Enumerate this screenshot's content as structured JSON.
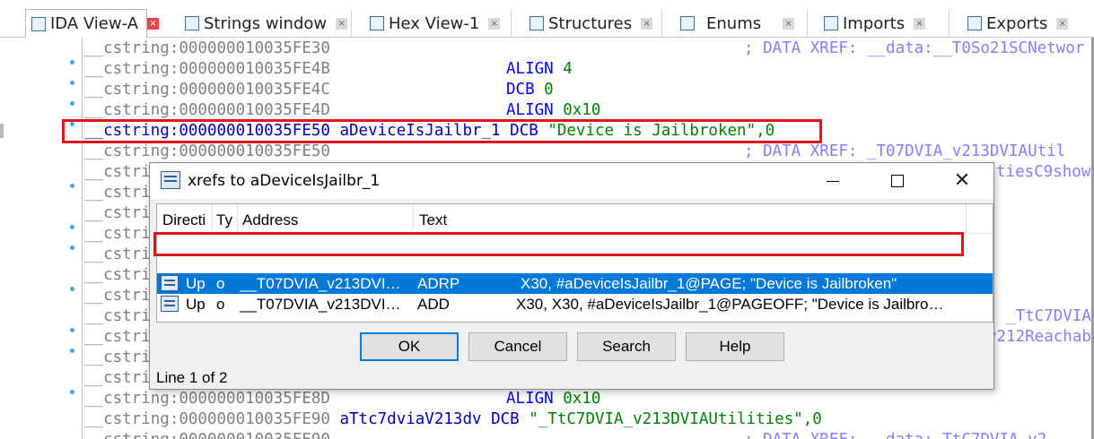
{
  "tabs": [
    {
      "label": "IDA View-A",
      "icon": "ida-view-icon",
      "active": true
    },
    {
      "label": "Strings window",
      "icon": "strings-icon",
      "active": false
    },
    {
      "label": "Hex View-1",
      "icon": "hex-icon",
      "active": false
    },
    {
      "label": "Structures",
      "icon": "structures-icon",
      "active": false
    },
    {
      "label": "Enums",
      "icon": "enums-icon",
      "active": false
    },
    {
      "label": "Imports",
      "icon": "imports-icon",
      "active": false
    },
    {
      "label": "Exports",
      "icon": "exports-icon",
      "active": false
    }
  ],
  "tab_close_glyph": "×",
  "listing": {
    "lines": [
      {
        "addr": "__cstring:000000010035FE30",
        "mn": "",
        "op": "",
        "comment": "; DATA XREF: __data:__T0So21SCNetwor"
      },
      {
        "addr": "__cstring:000000010035FE4B",
        "mn": "ALIGN",
        "op": "4",
        "comment": ""
      },
      {
        "addr": "__cstring:000000010035FE4C",
        "mn": "DCB",
        "op": "0",
        "comment": ""
      },
      {
        "addr": "__cstring:000000010035FE4D",
        "mn": "ALIGN",
        "op": "0x10",
        "comment": ""
      },
      {
        "addr": "__cstring:000000010035FE50",
        "mn": "",
        "op": "",
        "comment": ""
      },
      {
        "addr": "__cstring:000000010035FE50",
        "mn": "",
        "op": "",
        "comment": "; DATA XREF: _T07DVIA_v213DVIAUtil"
      },
      {
        "addr": "__cstri",
        "mn": "",
        "op": "",
        "comment": "tiesC9showA"
      },
      {
        "addr": "__cstri",
        "mn": "",
        "op": "",
        "comment": ""
      },
      {
        "addr": "__cstri",
        "mn": "",
        "op": "",
        "comment": ""
      },
      {
        "addr": "__cstri",
        "mn": "",
        "op": "",
        "comment": ""
      },
      {
        "addr": "__cstri",
        "mn": "",
        "op": "",
        "comment": ""
      },
      {
        "addr": "__cstri",
        "mn": "",
        "op": "",
        "comment": ""
      },
      {
        "addr": "__cstri",
        "mn": "",
        "op": "",
        "comment": ""
      },
      {
        "addr": "__cstri",
        "mn": "",
        "op": "",
        "comment": ": _TtC7DVIA_"
      },
      {
        "addr": "__cstri",
        "mn": "",
        "op": "",
        "comment": "v212Reachab"
      },
      {
        "addr": "__cstri",
        "mn": "",
        "op": "",
        "comment": ""
      },
      {
        "addr": "__cstri",
        "mn": "",
        "op": "",
        "comment": ""
      },
      {
        "addr": "__cstring:000000010035FE8D",
        "mn": "ALIGN",
        "op": "0x10",
        "comment": ""
      },
      {
        "addr": "__cstring:000000010035FE90",
        "mn": "",
        "op": "",
        "comment": ""
      },
      {
        "addr": "__cstring:000000010035FE90",
        "mn": "",
        "op": "",
        "comment": "; DATA XREF: __data:_TtC7DVIA_v2"
      }
    ],
    "selected_line": {
      "addr": "__cstring:000000010035FE50",
      "name": "aDeviceIsJailbr_1",
      "mn": "DCB",
      "value": "\"Device is Jailbroken\",0"
    },
    "line_19": {
      "addr": "__cstring:000000010035FE90",
      "name": "aTtc7dviaV213dv",
      "mn": "DCB",
      "value": "\"_TtC7DVIA_v213DVIAUtilities\",0"
    }
  },
  "dialog": {
    "title": "xrefs to aDeviceIsJailbr_1",
    "columns": [
      "Directi",
      "Ty",
      "Address",
      "Text"
    ],
    "rows": [
      {
        "direction": "Up",
        "type": "o",
        "address": "__T07DVIA_v213DVI…",
        "mnemonic": "ADRP",
        "operands": "X30, #aDeviceIsJailbr_1@PAGE; \"Device is Jailbroken\"",
        "selected": true
      },
      {
        "direction": "Up",
        "type": "o",
        "address": "__T07DVIA_v213DVI…",
        "mnemonic": "ADD",
        "operands": "X30, X30, #aDeviceIsJailbr_1@PAGEOFF; \"Device is Jailbro…",
        "selected": false
      }
    ],
    "buttons": {
      "ok": "OK",
      "cancel": "Cancel",
      "search": "Search",
      "help": "Help"
    },
    "status": "Line 1 of 2",
    "close_glyph": "✕"
  },
  "colors": {
    "selection": "#0078d7",
    "highlight_box": "#e0141b",
    "mnemonic": "#0000ff",
    "operand": "#008000",
    "comment": "#8080ff",
    "address": "#808080"
  }
}
